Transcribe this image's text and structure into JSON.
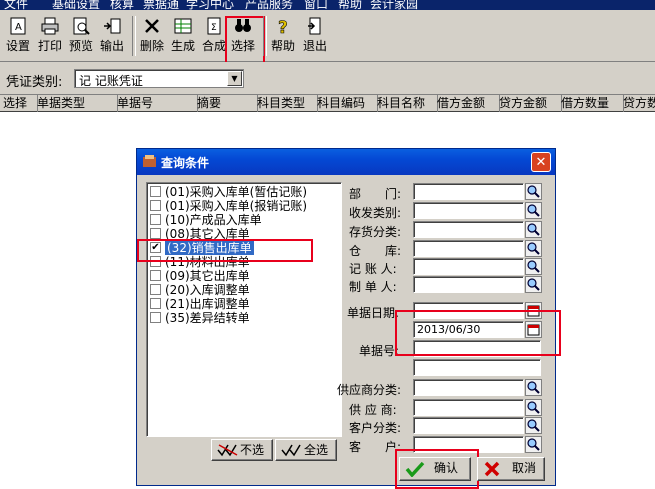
{
  "menu": [
    "文件",
    "基础设置",
    "核算",
    "票据通",
    "学习中心",
    "产品服务",
    "窗口",
    "帮助",
    "会计家园"
  ],
  "toolbar": {
    "settings": "设置",
    "print": "打印",
    "preview": "预览",
    "export": "输出",
    "delete": "删除",
    "generate": "生成",
    "merge": "合成",
    "select": "选择",
    "help": "帮助",
    "exit": "退出"
  },
  "voucher": {
    "label": "凭证类别:",
    "value": "记 记账凭证"
  },
  "grid_columns": [
    "选择",
    "单据类型",
    "单据号",
    "摘要",
    "科目类型",
    "科目编码",
    "科目名称",
    "借方金额",
    "贷方金额",
    "借方数量",
    "贷方数量"
  ],
  "dialog": {
    "title": "查询条件",
    "doc_types": [
      {
        "label": "(01)采购入库单(暂估记账)",
        "checked": false,
        "selected": false
      },
      {
        "label": "(01)采购入库单(报销记账)",
        "checked": false,
        "selected": false
      },
      {
        "label": "(10)产成品入库单",
        "checked": false,
        "selected": false
      },
      {
        "label": "(08)其它入库单",
        "checked": false,
        "selected": false
      },
      {
        "label": "(32)销售出库单",
        "checked": true,
        "selected": true
      },
      {
        "label": "(11)材料出库单",
        "checked": false,
        "selected": false
      },
      {
        "label": "(09)其它出库单",
        "checked": false,
        "selected": false
      },
      {
        "label": "(20)入库调整单",
        "checked": false,
        "selected": false
      },
      {
        "label": "(21)出库调整单",
        "checked": false,
        "selected": false
      },
      {
        "label": "(35)差异结转单",
        "checked": false,
        "selected": false
      }
    ],
    "fields": {
      "department": "部　　门:",
      "receive_type": "收发类别:",
      "inventory_class": "存货分类:",
      "warehouse": "仓　　库:",
      "bookkeeper": "记 账 人:",
      "maker": "制 单 人:",
      "doc_date": "单据日期:",
      "doc_date_to": "2013/06/30",
      "doc_no": "单据号:",
      "supplier_class": "供应商分类:",
      "supplier": "供 应 商:",
      "customer_class": "客户分类:",
      "customer": "客　　户:"
    },
    "buttons": {
      "deselect": "不选",
      "select_all": "全选",
      "ok": "确认",
      "cancel": "取消"
    }
  },
  "colors": {
    "highlight_box": "#e8001c",
    "title_bar": "#0448d4",
    "selection": "#316ac5"
  }
}
